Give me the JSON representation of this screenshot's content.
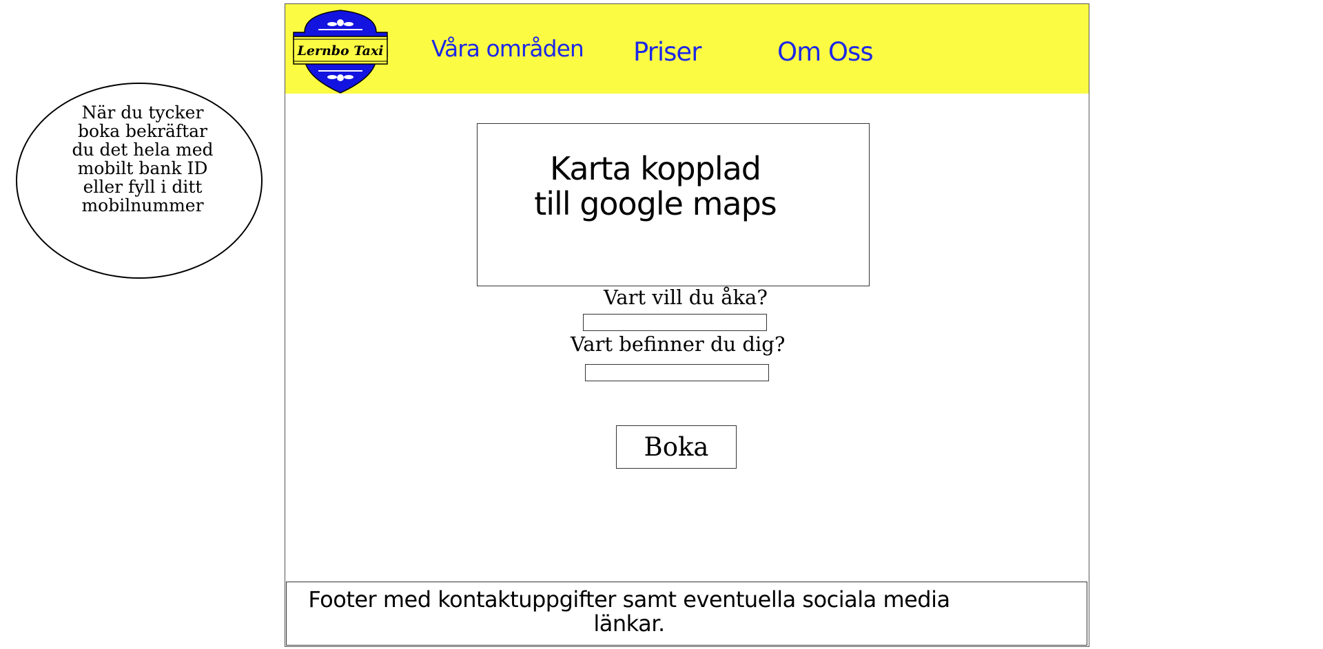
{
  "annotation": {
    "text": "När du tycker\nboka bekräftar\ndu det hela med\nmobilt bank ID\neller fyll i ditt\nmobilnummer"
  },
  "header": {
    "logo_text": "Lernbo Taxi",
    "nav": {
      "areas": "Våra områden",
      "prices": "Priser",
      "about": "Om Oss"
    }
  },
  "map": {
    "placeholder_text": "Karta kopplad\ntill google maps"
  },
  "form": {
    "destination_label": "Vart vill du åka?",
    "destination_value": "",
    "origin_label": "Vart befinner du dig?",
    "origin_value": "",
    "book_label": "Boka"
  },
  "footer": {
    "text": "Footer med kontaktuppgifter samt eventuella sociala media\nlänkar."
  },
  "colors": {
    "header_bg": "#fbfb44",
    "nav_link": "#1d28e6",
    "logo_blue": "#1414e0"
  }
}
